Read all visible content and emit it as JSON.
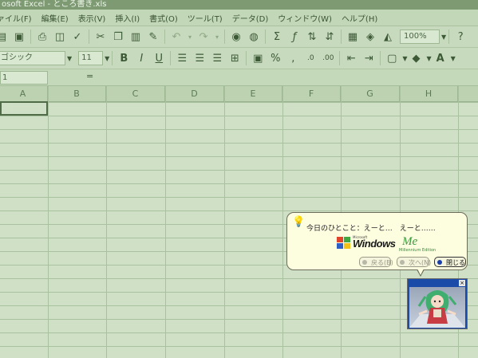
{
  "window": {
    "title": "osoft Excel - ところ書き.xls"
  },
  "menubar": {
    "items": [
      "ァイル(F)",
      "編集(E)",
      "表示(V)",
      "挿入(I)",
      "書式(O)",
      "ツール(T)",
      "データ(D)",
      "ウィンドウ(W)",
      "ヘルプ(H)"
    ]
  },
  "toolbar": {
    "zoom": "100%",
    "font_name": "ゴシック",
    "font_size": "11",
    "currency_label": "%",
    "comma_label": ","
  },
  "formula_bar": {
    "name_box": "1",
    "fx": "="
  },
  "columns": [
    "A",
    "B",
    "C",
    "D",
    "E",
    "F",
    "G",
    "H"
  ],
  "assistant_balloon": {
    "message": "今日のひとこと：えーと…　えーと……",
    "logo_microsoft": "Microsoft",
    "logo_windows": "Windows",
    "logo_me": "Me",
    "logo_edition": "Millennium Edition",
    "back_label": "戻る(B)",
    "next_label": "次へ(N)",
    "close_label": "閉じる"
  },
  "assistant_window": {
    "close_symbol": "×"
  }
}
